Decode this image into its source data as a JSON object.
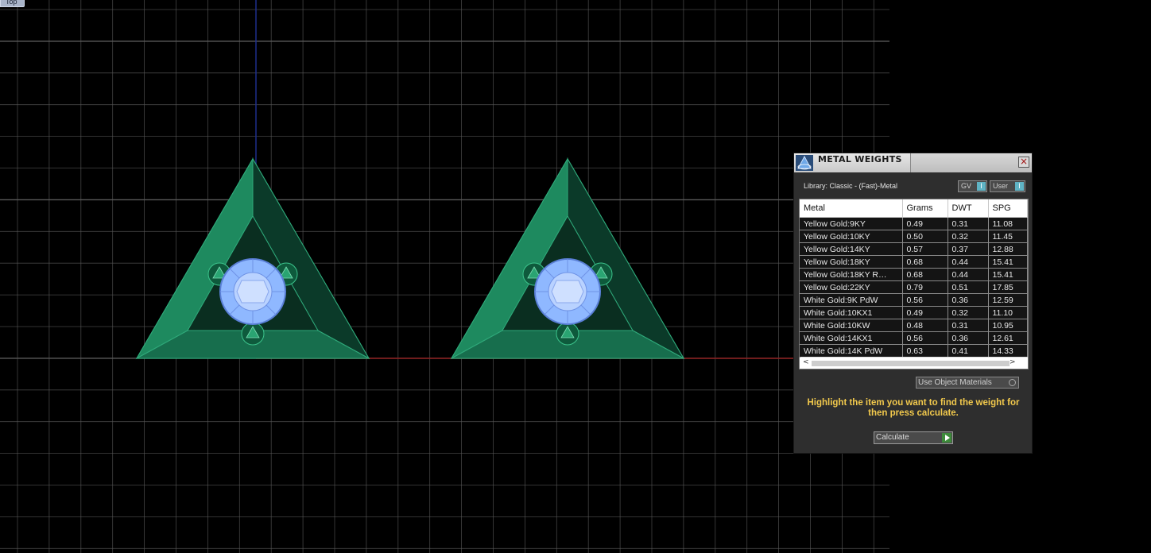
{
  "viewport": {
    "view_label": "Top",
    "grid_color": "#5a5a5a",
    "axis_x_color": "#8b1c1c",
    "axis_y_color": "#1e2f8c",
    "metal_color": "#1f8f63",
    "gem_color": "#8fb8ff"
  },
  "panel": {
    "title": "METAL WEIGHTS",
    "close_label": "×",
    "library_label": "Library: Classic - (Fast)-Metal",
    "gv_label": "GV",
    "gv_toggle": "I",
    "user_label": "User",
    "user_toggle": "I",
    "columns": [
      "Metal",
      "Grams",
      "DWT",
      "SPG"
    ],
    "rows": [
      [
        "Yellow Gold:9KY",
        "0.49",
        "0.31",
        "11.08"
      ],
      [
        "Yellow Gold:10KY",
        "0.50",
        "0.32",
        "11.45"
      ],
      [
        "Yellow Gold:14KY",
        "0.57",
        "0.37",
        "12.88"
      ],
      [
        "Yellow Gold:18KY",
        "0.68",
        "0.44",
        "15.41"
      ],
      [
        "Yellow Gold:18KY R…",
        "0.68",
        "0.44",
        "15.41"
      ],
      [
        "Yellow Gold:22KY",
        "0.79",
        "0.51",
        "17.85"
      ],
      [
        "White Gold:9K PdW",
        "0.56",
        "0.36",
        "12.59"
      ],
      [
        "White Gold:10KX1",
        "0.49",
        "0.32",
        "11.10"
      ],
      [
        "White Gold:10KW",
        "0.48",
        "0.31",
        "10.95"
      ],
      [
        "White Gold:14KX1",
        "0.56",
        "0.36",
        "12.61"
      ],
      [
        "White Gold:14K PdW",
        "0.63",
        "0.41",
        "14.33"
      ]
    ],
    "use_object_materials_label": "Use Object Materials",
    "instruction": "Highlight the item you want to find the weight for then press calculate.",
    "calculate_label": "Calculate"
  }
}
